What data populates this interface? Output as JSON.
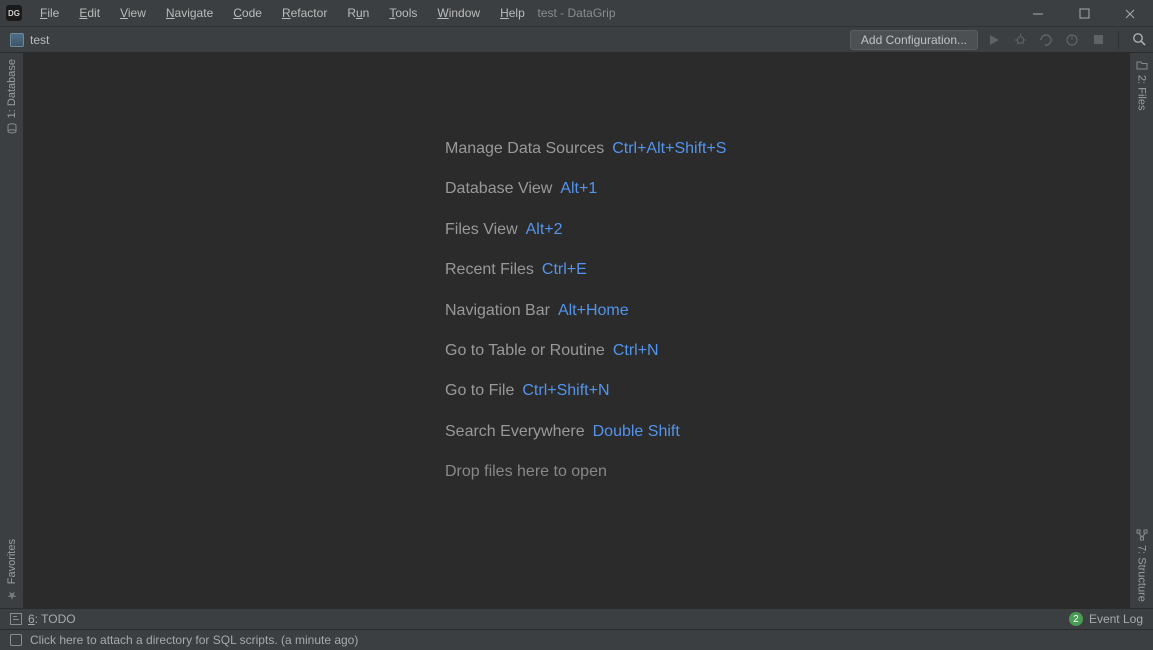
{
  "title": "test - DataGrip",
  "app_icon_label": "DG",
  "menu": {
    "file": "File",
    "edit": "Edit",
    "view": "View",
    "navigate": "Navigate",
    "code": "Code",
    "refactor": "Refactor",
    "run": "Run",
    "tools": "Tools",
    "window": "Window",
    "help": "Help"
  },
  "toolbar": {
    "project": "test",
    "add_config": "Add Configuration..."
  },
  "left_gutter": {
    "top": "1: Database",
    "bottom": "Favorites"
  },
  "right_gutter": {
    "top": "2: Files",
    "bottom": "7: Structure"
  },
  "welcome": [
    {
      "label": "Manage Data Sources",
      "shortcut": "Ctrl+Alt+Shift+S"
    },
    {
      "label": "Database View",
      "shortcut": "Alt+1"
    },
    {
      "label": "Files View",
      "shortcut": "Alt+2"
    },
    {
      "label": "Recent Files",
      "shortcut": "Ctrl+E"
    },
    {
      "label": "Navigation Bar",
      "shortcut": "Alt+Home"
    },
    {
      "label": "Go to Table or Routine",
      "shortcut": "Ctrl+N"
    },
    {
      "label": "Go to File",
      "shortcut": "Ctrl+Shift+N"
    },
    {
      "label": "Search Everywhere",
      "shortcut": "Double Shift"
    }
  ],
  "welcome_hint": "Drop files here to open",
  "bottom_bar": {
    "todo_prefix": "6",
    "todo": ": TODO",
    "event_count": "2",
    "event_log": "Event Log"
  },
  "status": {
    "message": "Click here to attach a directory for SQL scripts. (a minute ago)"
  }
}
